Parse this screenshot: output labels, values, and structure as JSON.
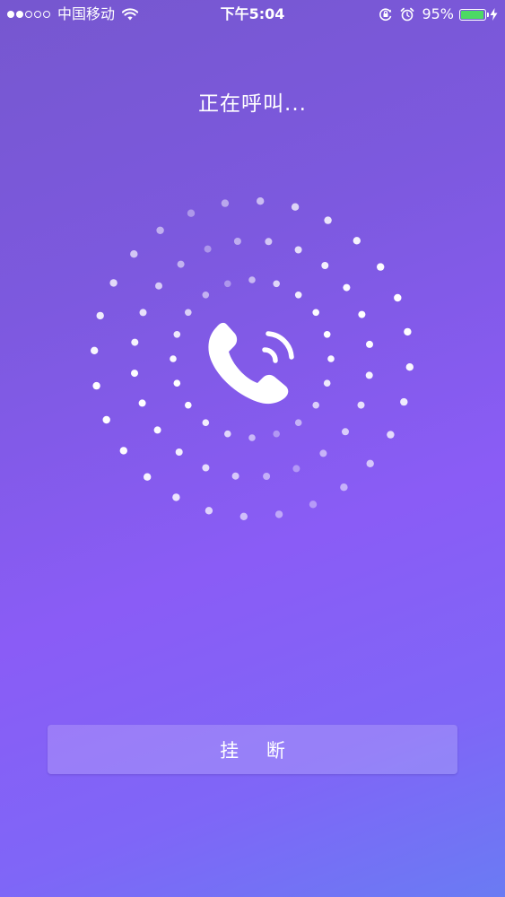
{
  "status_bar": {
    "carrier": "中国移动",
    "time": "下午5:04",
    "battery_percent_label": "95%",
    "battery_level": 0.95,
    "battery_color": "#4cd964",
    "signal_bars_filled": 2,
    "signal_bars_total": 5,
    "icons": [
      "wifi-icon",
      "orientation-lock-icon",
      "alarm-icon",
      "battery-icon",
      "charging-bolt-icon"
    ]
  },
  "call": {
    "status_text": "正在呼叫...",
    "icon": "phone-call-icon"
  },
  "actions": {
    "hangup_label": "挂 断"
  },
  "colors": {
    "background_top": "#7657cf",
    "background_mid": "#8a5cf6",
    "background_bottom": "#6a7bf3",
    "foreground": "#ffffff"
  }
}
